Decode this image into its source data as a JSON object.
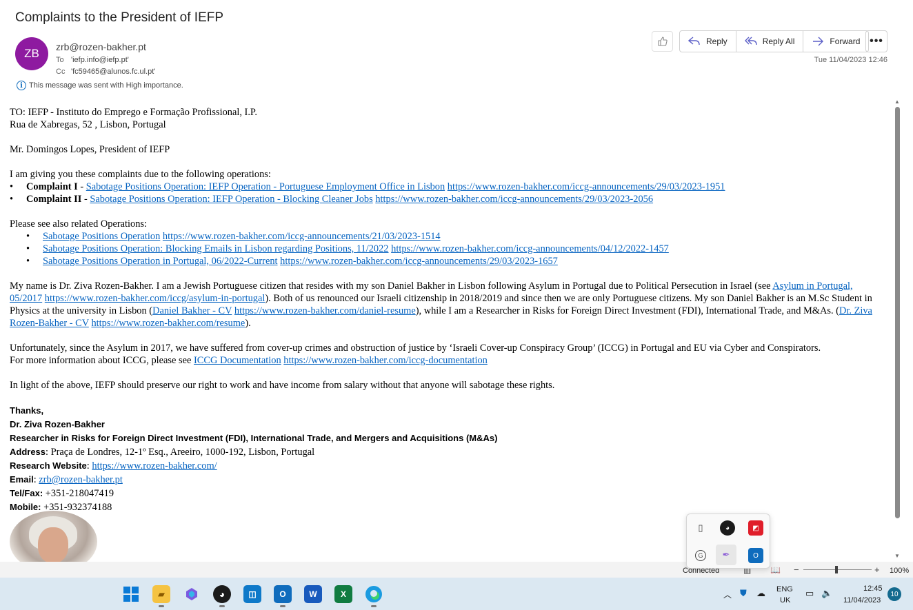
{
  "email": {
    "subject": "Complaints to the President of IEFP",
    "avatar_initials": "ZB",
    "from": "zrb@rozen-bakher.pt",
    "to_label": "To",
    "to": "'iefp.info@iefp.pt'",
    "cc_label": "Cc",
    "cc": "'fc59465@alunos.fc.ul.pt'",
    "importance_note": "This message was sent with High importance.",
    "date": "Tue 11/04/2023 12:46"
  },
  "actions": {
    "reply": "Reply",
    "reply_all": "Reply All",
    "forward": "Forward"
  },
  "body": {
    "to_line": "TO: IEFP - Instituto do Emprego e Formação Profissional, I.P.",
    "address_line": "Rua de Xabregas, 52 , Lisbon, Portugal",
    "salutation": "Mr. Domingos Lopes, President of IEFP",
    "intro": "I am giving you these complaints due to the following operations:",
    "complaints": [
      {
        "label": "Complaint I",
        "sep": " - ",
        "link": "Sabotage Positions Operation: IEFP Operation - Portuguese Employment Office in Lisbon",
        "url": "https://www.rozen-bakher.com/iccg-announcements/29/03/2023-1951"
      },
      {
        "label": "Complaint II",
        "sep": " - ",
        "link": "Sabotage Positions Operation: IEFP Operation - Blocking Cleaner Jobs",
        "url": "https://www.rozen-bakher.com/iccg-announcements/29/03/2023-2056"
      }
    ],
    "related_intro": "Please see also related Operations:",
    "related": [
      {
        "link": "Sabotage Positions Operation",
        "url": "https://www.rozen-bakher.com/iccg-announcements/21/03/2023-1514"
      },
      {
        "link": "Sabotage Positions Operation: Blocking Emails in Lisbon regarding Positions, 11/2022",
        "url": "https://www.rozen-bakher.com/iccg-announcements/04/12/2022-1457"
      },
      {
        "link": "Sabotage Positions Operation in Portugal, 06/2022-Current",
        "url": "https://www.rozen-bakher.com/iccg-announcements/29/03/2023-1657"
      }
    ],
    "para1": {
      "t1": "My name is Dr. Ziva Rozen-Bakher. I am a Jewish Portuguese citizen that resides with my son Daniel Bakher in Lisbon following Asylum in Portugal due to Political Persecution in Israel (see ",
      "l1": "Asylum in Portugal, 05/2017",
      "u1": "https://www.rozen-bakher.com/iccg/asylum-in-portugal",
      "t2": "). Both of us renounced our Israeli citizenship in 2018/2019 and since then we are only Portuguese citizens. My son Daniel Bakher is an M.Sc Student in Physics at the university in Lisbon (",
      "l2": "Daniel Bakher - CV",
      "u2": "https://www.rozen-bakher.com/daniel-resume",
      "t3": "), while I am a Researcher in Risks for Foreign Direct Investment (FDI), International Trade, and M&As. (",
      "l3": "Dr. Ziva Rozen-Bakher - CV",
      "u3": "https://www.rozen-bakher.com/resume",
      "t4": ")."
    },
    "para2": "Unfortunately, since the Asylum in 2017, we have suffered from cover-up crimes and obstruction of justice by ‘Israeli Cover-up Conspiracy Group’ (ICCG) in Portugal and EU via Cyber and Conspirators.",
    "para3": {
      "t1": "For more information about ICCG, please see ",
      "l1": "ICCG Documentation",
      "u1": "https://www.rozen-bakher.com/iccg-documentation"
    },
    "para4": "In light of the above, IEFP should preserve our right to work and have income from salary without that anyone will sabotage these rights.",
    "signature": {
      "thanks": "Thanks,",
      "name": "Dr. Ziva Rozen-Bakher",
      "title": "Researcher in Risks for Foreign Direct Investment (FDI), International Trade, and Mergers and Acquisitions (M&As)",
      "address_label": "Address",
      "address": ": Praça de Londres, 12-1º Esq., Areeiro, 1000-192, Lisbon, Portugal",
      "website_label": "Research Website",
      "website": "https://www.rozen-bakher.com/",
      "email_label": "Email",
      "email": "zrb@rozen-bakher.pt",
      "tel_label": "Tel/Fax:",
      "tel": " +351-218047419",
      "mobile_label": "Mobile:",
      "mobile": " +351-932374188"
    }
  },
  "status_bar": {
    "connection": "Connected",
    "zoom_minus": "−",
    "zoom_plus": "+",
    "zoom": "100%",
    "zoom_fraction": 0.47
  },
  "taskbar": {
    "language": "ENG",
    "region": "UK",
    "time": "12:45",
    "date": "11/04/2023",
    "notifications": "10"
  },
  "colors": {
    "avatar": "#8e1aa0",
    "link": "#0563c1",
    "accent": "#5b5fc7",
    "taskbar": "#dbe8f2"
  }
}
